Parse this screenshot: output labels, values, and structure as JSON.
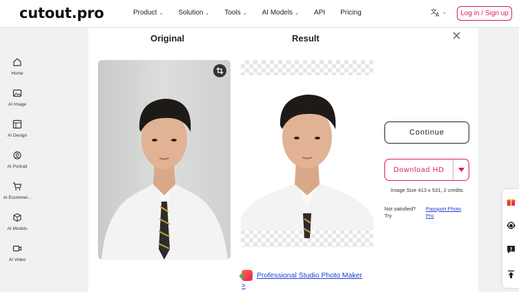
{
  "header": {
    "logo": "cutout.pro",
    "nav": [
      {
        "label": "Product",
        "has_dropdown": true
      },
      {
        "label": "Solution",
        "has_dropdown": true
      },
      {
        "label": "Tools",
        "has_dropdown": true
      },
      {
        "label": "AI Models",
        "has_dropdown": true
      },
      {
        "label": "API",
        "has_dropdown": false
      },
      {
        "label": "Pricing",
        "has_dropdown": false
      }
    ],
    "language_icon": "translate-icon",
    "login_label": "Log in / Sign up"
  },
  "sidebar": {
    "items": [
      {
        "label": "Home",
        "icon": "home-icon"
      },
      {
        "label": "AI Image",
        "icon": "image-icon"
      },
      {
        "label": "AI Design",
        "icon": "layout-icon"
      },
      {
        "label": "AI Portrait",
        "icon": "portrait-icon"
      },
      {
        "label": "AI Ecommer...",
        "icon": "cart-icon"
      },
      {
        "label": "AI Models",
        "icon": "cube-icon"
      },
      {
        "label": "AI Video",
        "icon": "video-icon"
      }
    ]
  },
  "main": {
    "original_title": "Original",
    "result_title": "Result",
    "continue_label": "Continue",
    "download_label": "Download HD",
    "image_size_text": "Image Size 413 x 531, 2 credits",
    "not_satisfied_text": "Not satisfied? Try",
    "passport_link": "Passport Photo Pro",
    "promo_link": "Professional Studio Photo Maker",
    "promo_arrow": ">"
  },
  "colors": {
    "accent": "#d71c55",
    "link": "#1a3fd1"
  }
}
